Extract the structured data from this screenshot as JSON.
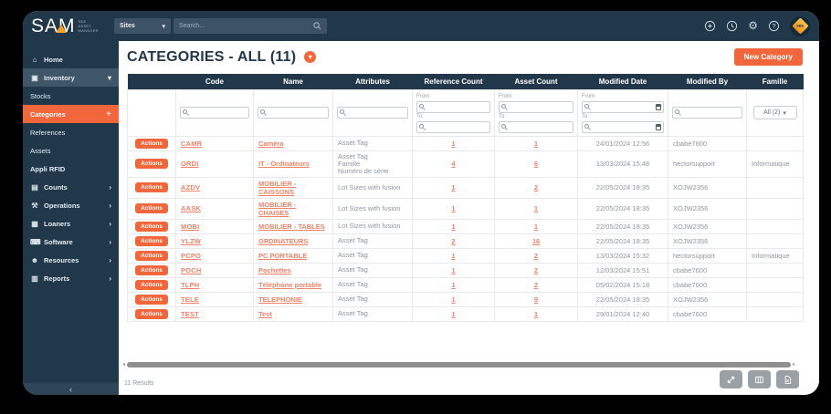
{
  "app": {
    "logo_text": "SAM",
    "logo_sub": "SEE\nASSET\nMANAGER"
  },
  "topbar": {
    "sites_label": "Sites",
    "search_placeholder": "Search...",
    "avatar_text": "SBE"
  },
  "icons": {
    "chevron_down": "▾",
    "chevron_right": "›",
    "plus": "+",
    "caret_down": "▾",
    "collapse": "‹",
    "scroll_left": "◂",
    "scroll_right": "▸",
    "title_badge": "▾",
    "gear": "⚙",
    "house": "⌂",
    "inventory": "▣",
    "counts": "▤",
    "operations": "⚒",
    "loaners": "▦",
    "software": "⌨",
    "resources": "☻",
    "reports": "▥"
  },
  "sidebar": {
    "items": [
      {
        "label": "Home",
        "icon": "house",
        "style": "top"
      },
      {
        "label": "Inventory",
        "icon": "inventory",
        "style": "expanded",
        "trail": "chevron_down"
      },
      {
        "label": "Stocks",
        "style": "sub"
      },
      {
        "label": "Categories",
        "style": "active",
        "trail": "plus"
      },
      {
        "label": "References",
        "style": "sub"
      },
      {
        "label": "Assets",
        "style": "sub"
      },
      {
        "label": "Appli RFID",
        "style": "sub bold"
      },
      {
        "label": "Counts",
        "icon": "counts",
        "style": "top",
        "trail": "chevron_right"
      },
      {
        "label": "Operations",
        "icon": "operations",
        "style": "top",
        "trail": "chevron_right"
      },
      {
        "label": "Loaners",
        "icon": "loaners",
        "style": "top",
        "trail": "chevron_right"
      },
      {
        "label": "Software",
        "icon": "software",
        "style": "top",
        "trail": "chevron_right"
      },
      {
        "label": "Resources",
        "icon": "resources",
        "style": "top",
        "trail": "chevron_right"
      },
      {
        "label": "Reports",
        "icon": "reports",
        "style": "top",
        "trail": "chevron_right"
      }
    ]
  },
  "page": {
    "title": "CATEGORIES - ALL (11)",
    "new_button_label": "New Category",
    "results_text": "11 Results"
  },
  "table": {
    "columns": [
      "",
      "Code",
      "Name",
      "Attributes",
      "Reference Count",
      "Asset Count",
      "Modified Date",
      "Modified By",
      "Famille"
    ],
    "filter": {
      "from_label": "From:",
      "to_label": "To:",
      "famille_value": "All (2)"
    },
    "rows": [
      {
        "actions_label": "Actions",
        "code": "CAMR",
        "name": "Caméra",
        "attributes": [
          "Asset Tag"
        ],
        "reference_count": "1",
        "asset_count": "1",
        "modified_date": "24/01/2024 12:56",
        "modified_by": "cbabe7600",
        "famille": ""
      },
      {
        "actions_label": "Actions",
        "code": "ORDI",
        "name": "IT - Ordinateurs",
        "attributes": [
          "Asset Tag",
          "Famille",
          "Numéro de série"
        ],
        "reference_count": "4",
        "asset_count": "6",
        "modified_date": "13/03/2024 15:48",
        "modified_by": "hectorsupport",
        "famille": "Informatique"
      },
      {
        "actions_label": "Actions",
        "code": "AZDV",
        "name": "MOBILIER - CAISSONS",
        "attributes": [
          "Lot Sizes with fusion"
        ],
        "reference_count": "1",
        "asset_count": "2",
        "modified_date": "22/05/2024 18:35",
        "modified_by": "XOJW2356",
        "famille": ""
      },
      {
        "actions_label": "Actions",
        "code": "AASK",
        "name": "MOBILIER - CHAISES",
        "attributes": [
          "Lot Sizes with fusion"
        ],
        "reference_count": "1",
        "asset_count": "1",
        "modified_date": "22/05/2024 18:35",
        "modified_by": "XOJW2356",
        "famille": ""
      },
      {
        "actions_label": "Actions",
        "code": "MOBI",
        "name": "MOBILIER - TABLES",
        "attributes": [
          "Lot Sizes with fusion"
        ],
        "reference_count": "1",
        "asset_count": "1",
        "modified_date": "22/05/2024 18:35",
        "modified_by": "XOJW2356",
        "famille": ""
      },
      {
        "actions_label": "Actions",
        "code": "YLZW",
        "name": "ORDINATEURS",
        "attributes": [
          "Asset Tag"
        ],
        "reference_count": "2",
        "asset_count": "16",
        "modified_date": "22/05/2024 18:35",
        "modified_by": "XOJW2356",
        "famille": ""
      },
      {
        "actions_label": "Actions",
        "code": "PCPO",
        "name": "PC PORTABLE",
        "attributes": [
          "Asset Tag"
        ],
        "reference_count": "1",
        "asset_count": "2",
        "modified_date": "13/03/2024 15:32",
        "modified_by": "hectorsupport",
        "famille": "Informatique"
      },
      {
        "actions_label": "Actions",
        "code": "POCH",
        "name": "Pochettes",
        "attributes": [
          "Asset Tag"
        ],
        "reference_count": "1",
        "asset_count": "2",
        "modified_date": "12/03/2024 15:51",
        "modified_by": "cbabe7600",
        "famille": ""
      },
      {
        "actions_label": "Actions",
        "code": "TLPH",
        "name": "Téléphone portable",
        "attributes": [
          "Asset Tag"
        ],
        "reference_count": "1",
        "asset_count": "2",
        "modified_date": "05/02/2024 15:18",
        "modified_by": "cbabe7600",
        "famille": ""
      },
      {
        "actions_label": "Actions",
        "code": "TELE",
        "name": "TELEPHONIE",
        "attributes": [
          "Asset Tag"
        ],
        "reference_count": "1",
        "asset_count": "9",
        "modified_date": "22/05/2024 18:35",
        "modified_by": "XOJW2356",
        "famille": ""
      },
      {
        "actions_label": "Actions",
        "code": "TEST",
        "name": "Test",
        "attributes": [
          "Asset Tag"
        ],
        "reference_count": "1",
        "asset_count": "1",
        "modified_date": "29/01/2024 12:40",
        "modified_by": "cbabe7600",
        "famille": ""
      }
    ]
  }
}
